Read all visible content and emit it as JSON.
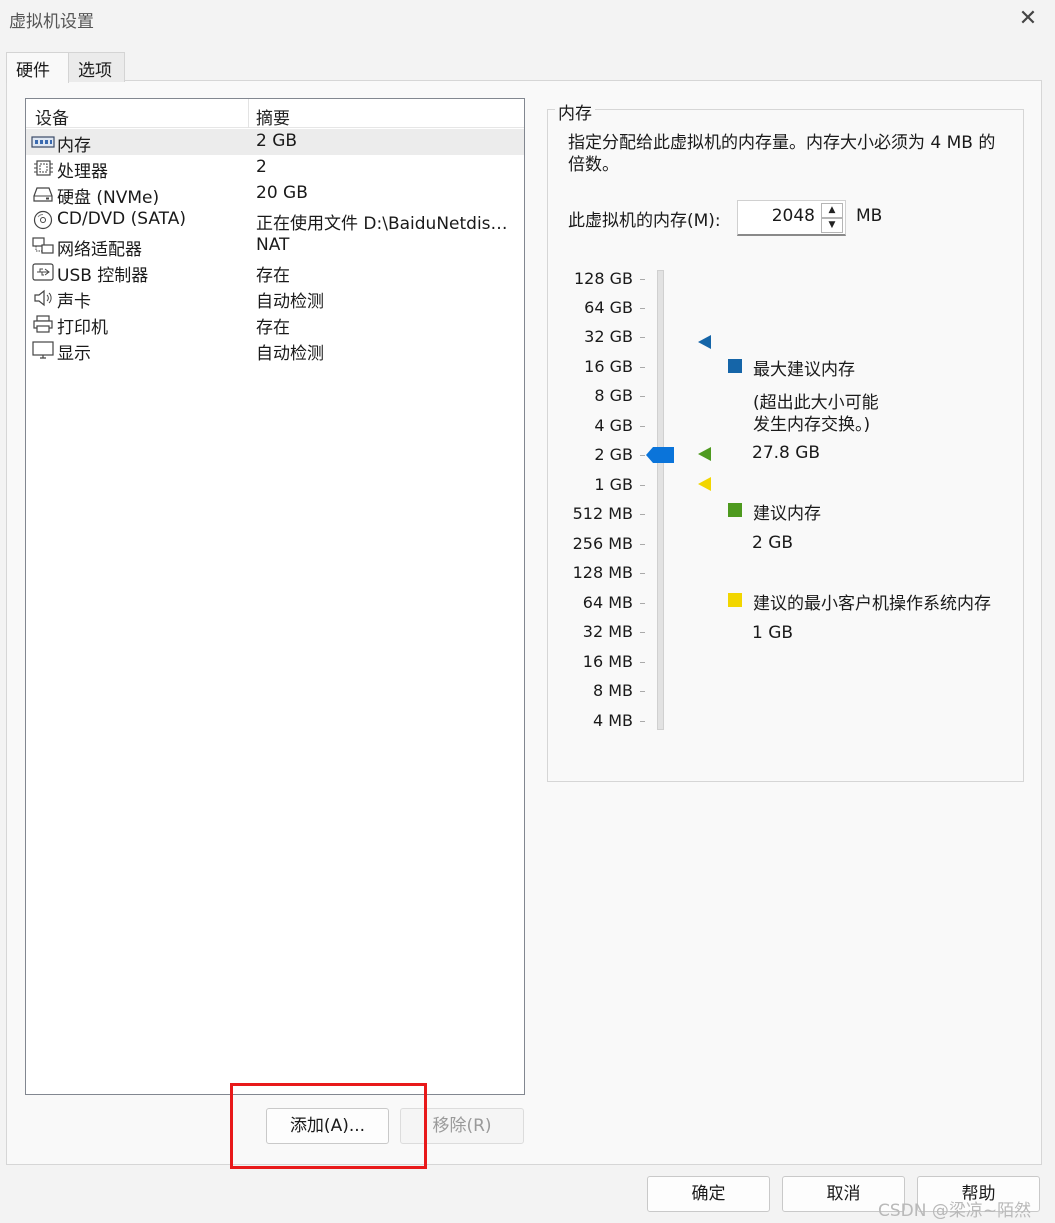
{
  "window": {
    "title": "虚拟机设置"
  },
  "tabs": [
    {
      "label": "硬件"
    },
    {
      "label": "选项"
    }
  ],
  "device_list": {
    "columns": [
      "设备",
      "摘要"
    ],
    "rows": [
      {
        "icon": "memory-icon",
        "name": "内存",
        "summary": "2 GB"
      },
      {
        "icon": "processor-icon",
        "name": "处理器",
        "summary": "2"
      },
      {
        "icon": "harddisk-icon",
        "name": "硬盘 (NVMe)",
        "summary": "20 GB"
      },
      {
        "icon": "cd-dvd-icon",
        "name": "CD/DVD (SATA)",
        "summary": "正在使用文件 D:\\BaiduNetdisk..."
      },
      {
        "icon": "network-adapter-icon",
        "name": "网络适配器",
        "summary": "NAT"
      },
      {
        "icon": "usb-icon",
        "name": "USB 控制器",
        "summary": "存在"
      },
      {
        "icon": "sound-card-icon",
        "name": "声卡",
        "summary": "自动检测"
      },
      {
        "icon": "printer-icon",
        "name": "打印机",
        "summary": "存在"
      },
      {
        "icon": "display-icon",
        "name": "显示",
        "summary": "自动检测"
      }
    ]
  },
  "buttons": {
    "add": "添加(A)...",
    "remove": "移除(R)",
    "ok": "确定",
    "cancel": "取消",
    "help": "帮助"
  },
  "memory": {
    "group_title": "内存",
    "description": "指定分配给此虚拟机的内存量。内存大小必须为 4 MB 的倍数。",
    "field_label": "此虚拟机的内存(M):",
    "value": "2048",
    "unit": "MB",
    "scale": [
      "128 GB",
      "64 GB",
      "32 GB",
      "16 GB",
      "8 GB",
      "4 GB",
      "2 GB",
      "1 GB",
      "512 MB",
      "256 MB",
      "128 MB",
      "64 MB",
      "32 MB",
      "16 MB",
      "8 MB",
      "4 MB"
    ],
    "selected_level": "2 GB",
    "legend": {
      "max": {
        "label": "最大建议内存",
        "note_line1": "(超出此大小可能",
        "note_line2": "发生内存交换。)",
        "value": "27.8 GB",
        "color": "#1565a8"
      },
      "recommended": {
        "label": "建议内存",
        "value": "2 GB",
        "color": "#4e9a1f"
      },
      "min_guest": {
        "label": "建议的最小客户机操作系统内存",
        "value": "1 GB",
        "color": "#f2d600"
      }
    }
  },
  "watermark": "CSDN @梁凉~陌然"
}
